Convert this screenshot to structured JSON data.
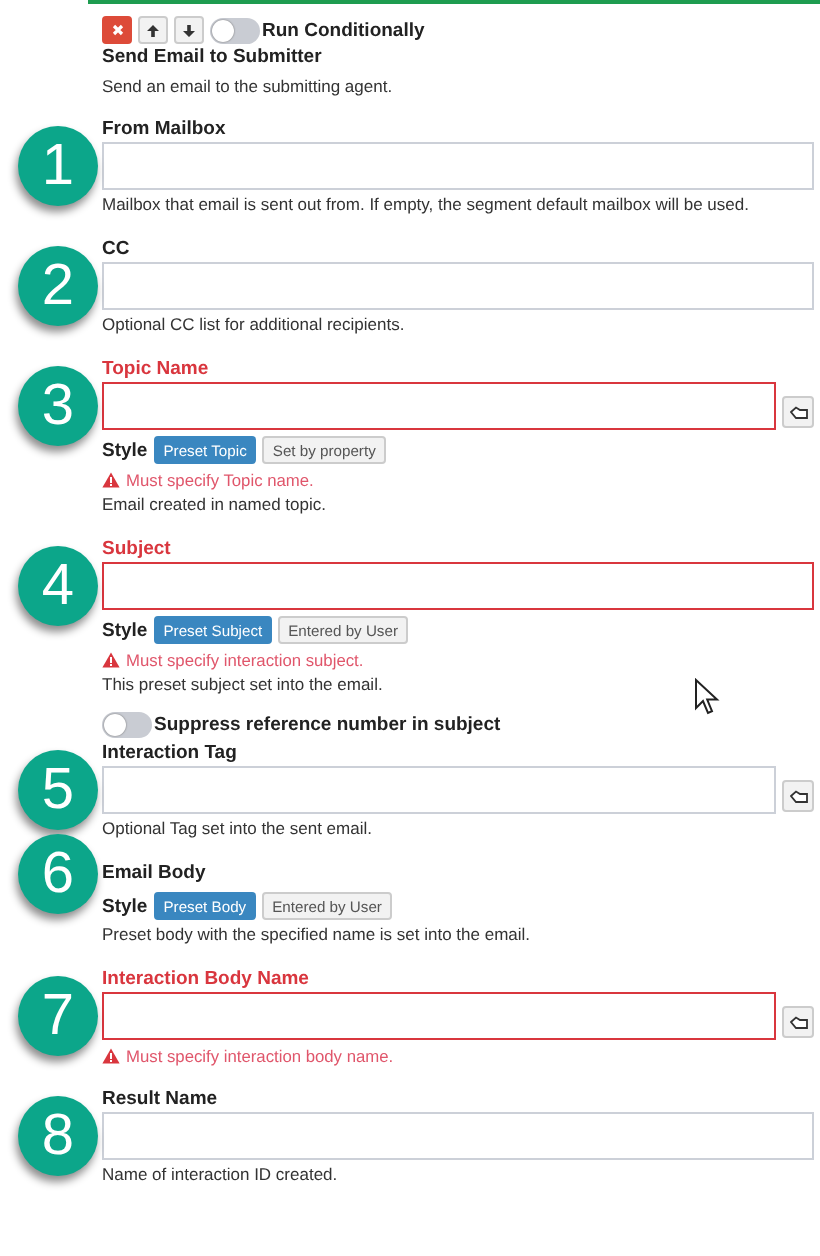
{
  "header": {
    "run_conditionally": {
      "label": "Run Conditionally",
      "on": false
    },
    "title": "Send Email to Submitter",
    "description": "Send an email to the submitting agent."
  },
  "sections": [
    {
      "kind": "field",
      "badge": "1",
      "label": "From Mailbox",
      "invalid": false,
      "picker": false,
      "help": "Mailbox that email is sent out from. If empty, the segment default mailbox will be used."
    },
    {
      "kind": "field",
      "badge": "2",
      "label": "CC",
      "invalid": false,
      "picker": false,
      "help": "Optional CC list for additional recipients."
    },
    {
      "kind": "field",
      "badge": "3",
      "label": "Topic Name",
      "invalid": true,
      "picker": true,
      "style": {
        "label": "Style",
        "options": [
          {
            "label": "Preset Topic",
            "selected": true
          },
          {
            "label": "Set by property",
            "selected": false
          }
        ]
      },
      "error": "Must specify Topic name.",
      "help": "Email created in named topic."
    },
    {
      "kind": "field",
      "badge": "4",
      "label": "Subject",
      "invalid": true,
      "picker": false,
      "style": {
        "label": "Style",
        "options": [
          {
            "label": "Preset Subject",
            "selected": true
          },
          {
            "label": "Entered by User",
            "selected": false
          }
        ]
      },
      "error": "Must specify interaction subject.",
      "help": "This preset subject set into the email."
    },
    {
      "kind": "toggle",
      "label": "Suppress reference number in subject",
      "on": false
    },
    {
      "kind": "field",
      "badge": "5",
      "label": "Interaction Tag",
      "invalid": false,
      "picker": true,
      "help": "Optional Tag set into the sent email."
    },
    {
      "kind": "choice",
      "badge": "6",
      "label": "Email Body",
      "style": {
        "label": "Style",
        "options": [
          {
            "label": "Preset Body",
            "selected": true
          },
          {
            "label": "Entered by User",
            "selected": false
          }
        ]
      },
      "help": "Preset body with the specified name is set into the email."
    },
    {
      "kind": "field",
      "badge": "7",
      "label": "Interaction Body Name",
      "invalid": true,
      "picker": true,
      "error": "Must specify interaction body name."
    },
    {
      "kind": "field",
      "badge": "8",
      "label": "Result Name",
      "invalid": false,
      "picker": false,
      "help": "Name of interaction ID created."
    }
  ]
}
